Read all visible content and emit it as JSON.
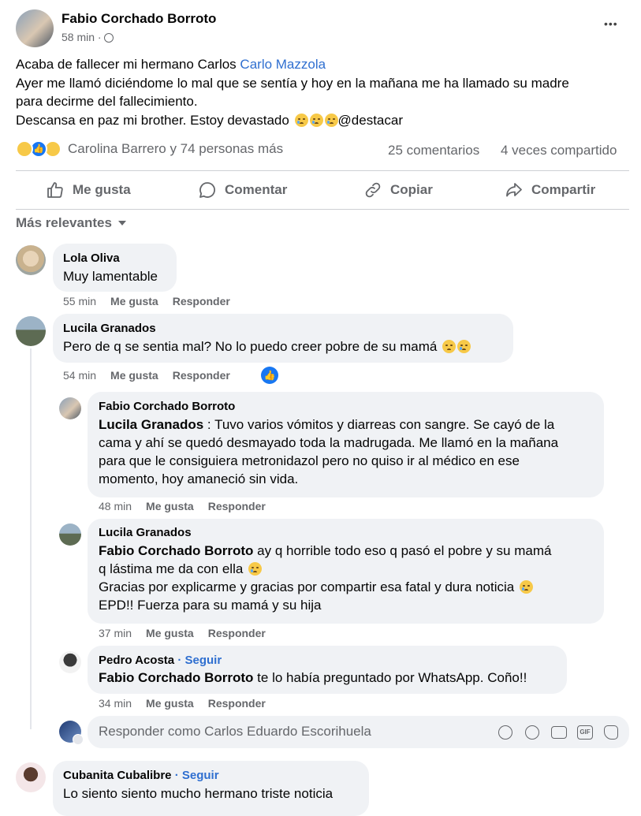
{
  "post": {
    "author": "Fabio Corchado Borroto",
    "time": "58 min",
    "more": "•••",
    "line1": "Acaba de fallecer mi hermano Carlos ",
    "mention": "Carlo Mazzola",
    "line2": "Ayer me llamó diciéndome lo mal que se sentía y hoy en la mañana me ha llamado su madre",
    "line3": "para decirme del fallecimiento.",
    "line4": "Descansa en paz mi brother. Estoy devastado ",
    "line4_tag": "@destacar",
    "reactions_text": "Carolina Barrero y 74 personas más",
    "comments_count": "25 comentarios",
    "shares_count": "4 veces compartido"
  },
  "actions": {
    "like": "Me gusta",
    "comment": "Comentar",
    "copy": "Copiar",
    "share": "Compartir"
  },
  "sort_label": "Más relevantes",
  "comments": [
    {
      "name": "Lola Oliva",
      "text": "Muy lamentable",
      "time": "55 min",
      "like": "Me gusta",
      "reply": "Responder"
    },
    {
      "name": "Lucila Granados",
      "text": "Pero de q se sentia mal? No lo puedo creer pobre de su mamá ",
      "time": "54 min",
      "like": "Me gusta",
      "reply": "Responder"
    }
  ],
  "replies": [
    {
      "name": "Fabio Corchado Borroto",
      "mention": "Lucila Granados",
      "line1": " : Tuvo varios vómitos y diarreas con sangre. Se cayó de la",
      "line2": "cama y ahí se quedó desmayado toda la madrugada. Me llamó en la mañana",
      "line3": "para que le consiguiera metronidazol pero no quiso ir al médico en ese",
      "line4": "momento, hoy amaneció sin vida.",
      "time": "48 min",
      "like": "Me gusta",
      "reply": "Responder"
    },
    {
      "name": "Lucila Granados",
      "mention": "Fabio Corchado Borroto",
      "line1": " ay q horrible todo eso q pasó el pobre y su mamá",
      "line2": "q lástima me da con ella ",
      "line3": "Gracias por explicarme y gracias por compartir esa fatal y dura noticia ",
      "line4": "EPD!! Fuerza para su mamá y su hija",
      "time": "37 min",
      "like": "Me gusta",
      "reply": "Responder"
    },
    {
      "name": "Pedro Acosta",
      "follow": "· Seguir",
      "mention": "Fabio Corchado Borroto",
      "line1": " te lo había preguntado por WhatsApp. Coño!!",
      "time": "34 min",
      "like": "Me gusta",
      "reply": "Responder"
    }
  ],
  "reply_box": {
    "placeholder": "Responder como Carlos Eduardo Escorihuela"
  },
  "last_comment": {
    "name": "Cubanita Cubalibre",
    "follow": "· Seguir",
    "text": "Lo siento siento mucho hermano triste noticia"
  }
}
